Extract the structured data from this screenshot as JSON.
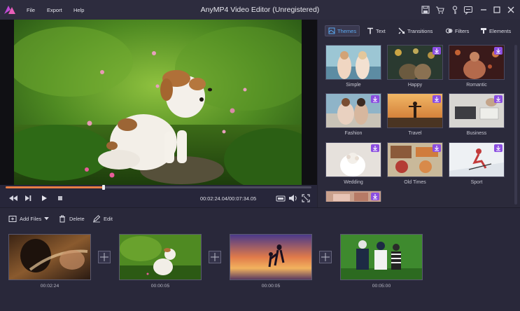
{
  "window": {
    "title": "AnyMP4 Video Editor (Unregistered)",
    "menu": [
      "File",
      "Export",
      "Help"
    ]
  },
  "titlebar_icons": [
    "save-icon",
    "cart-icon",
    "key-icon",
    "feedback-icon",
    "minimize-icon",
    "maximize-icon",
    "close-icon"
  ],
  "player": {
    "timecode": "00:02:24.04/00:07:34.05",
    "progress": 0.32
  },
  "panel": {
    "tabs": [
      {
        "label": "Themes",
        "icon": "themes-icon",
        "active": true
      },
      {
        "label": "Text",
        "icon": "text-icon",
        "active": false
      },
      {
        "label": "Transitions",
        "icon": "transitions-icon",
        "active": false
      },
      {
        "label": "Filters",
        "icon": "filters-icon",
        "active": false
      },
      {
        "label": "Elements",
        "icon": "elements-icon",
        "active": false
      }
    ],
    "themes": [
      {
        "label": "Simple",
        "download": false
      },
      {
        "label": "Happy",
        "download": true
      },
      {
        "label": "Romantic",
        "download": true
      },
      {
        "label": "Fashion",
        "download": true
      },
      {
        "label": "Travel",
        "download": true
      },
      {
        "label": "Business",
        "download": true
      },
      {
        "label": "Wedding",
        "download": true
      },
      {
        "label": "Old Times",
        "download": true
      },
      {
        "label": "Sport",
        "download": true
      },
      {
        "label": "",
        "download": true
      }
    ]
  },
  "toolbar": {
    "add_files": "Add Files",
    "delete": "Delete",
    "edit": "Edit"
  },
  "timeline": {
    "clips": [
      {
        "duration": "00:02:24"
      },
      {
        "duration": "00:00:05"
      },
      {
        "duration": "00:00:05"
      },
      {
        "duration": "00:05:00"
      }
    ]
  },
  "colors": {
    "accent_orange": "#e77e45",
    "tab_active_blue": "#5aa9f0",
    "download_purple": "#8b4ee0",
    "background": "#2b2a3b"
  }
}
